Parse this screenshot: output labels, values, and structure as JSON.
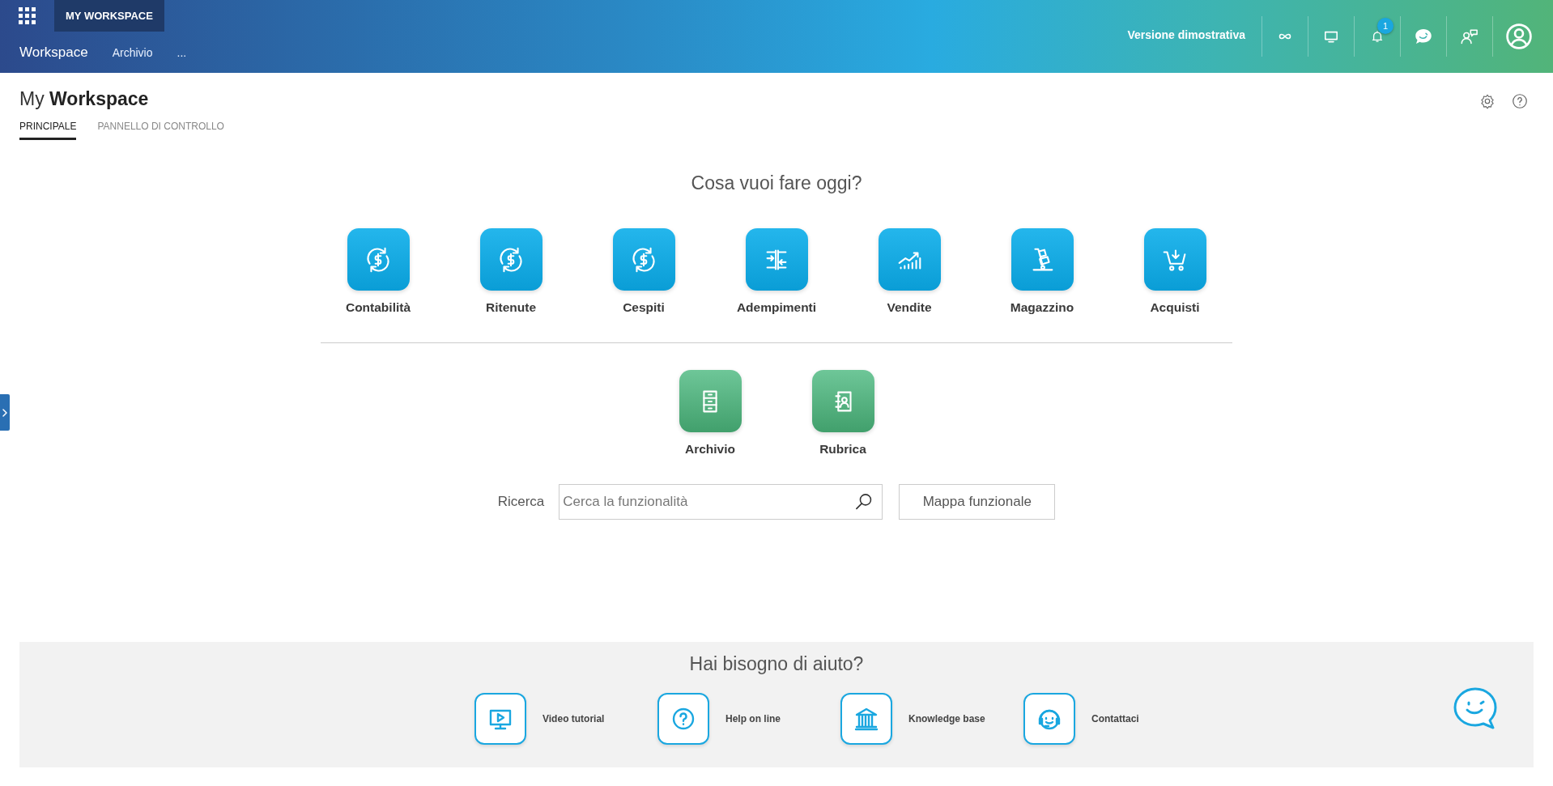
{
  "header": {
    "app_menu_label": "MY WORKSPACE",
    "nav": [
      {
        "label": "Workspace",
        "selected": true
      },
      {
        "label": "Archivio",
        "selected": false
      },
      {
        "label": "...",
        "selected": false
      }
    ],
    "version_label": "Versione dimostrativa",
    "notification_count": "1"
  },
  "page_title": "My **Workspace**",
  "tabs": [
    {
      "label": "PRINCIPALE",
      "selected": true
    },
    {
      "label": "PANNELLO DI CONTROLLO",
      "selected": false
    }
  ],
  "prompt": "Cosa vuoi fare oggi?",
  "main_apps": [
    "Contabilità",
    "Ritenute",
    "Cespiti",
    "Adempimenti",
    "Vendite",
    "Magazzino",
    "Acquisti"
  ],
  "other_apps": [
    "Archivio",
    "Rubrica"
  ],
  "search": {
    "label": "Ricerca",
    "placeholder": "Cerca la funzionalità",
    "button": "Mappa funzionale"
  },
  "help": {
    "title": "Hai bisogno di aiuto?",
    "items": [
      "Video tutorial",
      "Help on line",
      "Knowledge base",
      "Contattaci"
    ]
  }
}
